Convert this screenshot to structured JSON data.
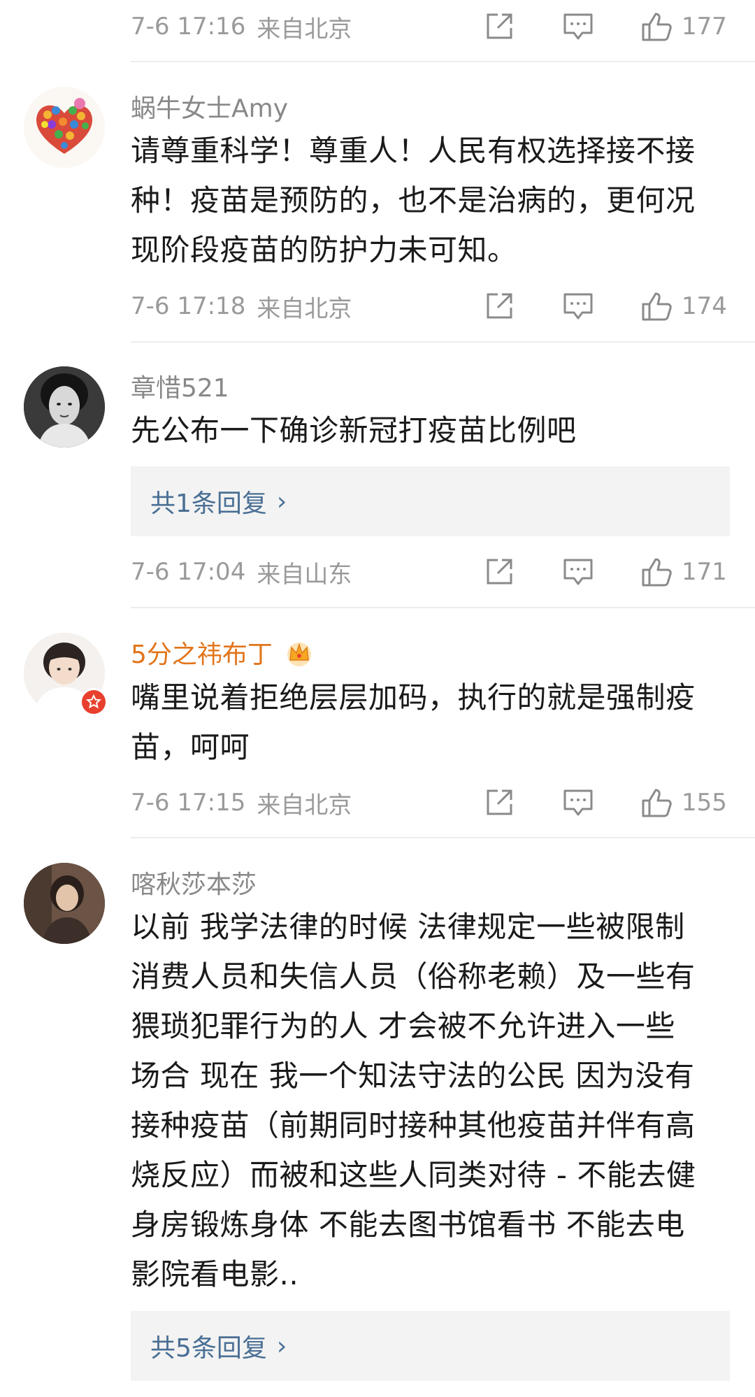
{
  "comments": [
    {
      "meta": {
        "time": "7-6 17:16",
        "source": "来自北京",
        "likes": "177"
      }
    },
    {
      "username": "蜗牛女士Amy",
      "text_lines": [
        "请尊重科学！尊重人！人民有权选择接不接",
        "种！疫苗是预防的，也不是治病的，更何况",
        "现阶段疫苗的防护力未可知。"
      ],
      "meta": {
        "time": "7-6 17:18",
        "source": "来自北京",
        "likes": "174"
      }
    },
    {
      "username": "章惜521",
      "text_lines": [
        "先公布一下确诊新冠打疫苗比例吧"
      ],
      "reply_label": "共1条回复",
      "meta": {
        "time": "7-6 17:04",
        "source": "来自山东",
        "likes": "171"
      }
    },
    {
      "username": "5分之祎布丁",
      "text_lines": [
        "嘴里说着拒绝层层加码，执行的就是强制疫",
        "苗，呵呵"
      ],
      "meta": {
        "time": "7-6 17:15",
        "source": "来自北京",
        "likes": "155"
      }
    },
    {
      "username": "喀秋莎本莎",
      "text_lines": [
        "以前 我学法律的时候 法律规定一些被限制",
        "消费人员和失信人员（俗称老赖）及一些有",
        "猥琐犯罪行为的人 才会被不允许进入一些",
        "场合 现在 我一个知法守法的公民 因为没有",
        "接种疫苗（前期同时接种其他疫苗并伴有高",
        "烧反应）而被和这些人同类对待 - 不能去健",
        "身房锻炼身体 不能去图书馆看书 不能去电",
        "影院看电影.."
      ],
      "reply_label": "共5条回复"
    }
  ],
  "icons": {
    "repost": "repost-icon",
    "comment": "comment-icon",
    "like": "thumbs-up-icon",
    "chevron": "chevron-right-icon",
    "crown": "crown-icon",
    "badge": "verified-badge-icon"
  },
  "colors": {
    "meta_text": "#9a9a9a",
    "vip_name": "#e2751b",
    "reply_link": "#4a6f94",
    "reply_bg": "#f3f3f3"
  }
}
